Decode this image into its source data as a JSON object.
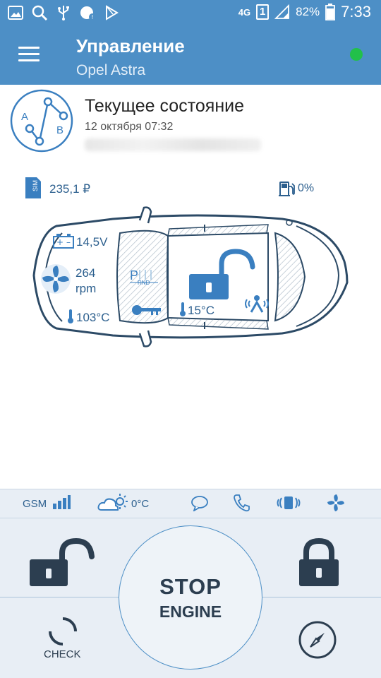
{
  "status_bar": {
    "network": "4G",
    "sim_slot": "1",
    "battery": "82%",
    "time": "7:33",
    "icons": [
      "image-icon",
      "search-icon",
      "usb-icon",
      "data-saver-icon",
      "play-store-icon",
      "signal-icon",
      "battery-icon"
    ]
  },
  "header": {
    "title": "Управление",
    "subtitle": "Opel Astra",
    "connection_color": "#22c04a"
  },
  "state": {
    "title": "Текущее состояние",
    "date": "12 октября 07:32",
    "logo_labels": {
      "a": "A",
      "b": "B"
    }
  },
  "sim": {
    "label": "SIM",
    "balance": "235,1 ₽"
  },
  "fuel": {
    "level": "0%"
  },
  "car": {
    "voltage": "14,5V",
    "rpm_value": "264",
    "rpm_unit": "rpm",
    "engine_temp": "103°C",
    "cabin_temp": "15°C",
    "gear_letters": {
      "park": "P",
      "others": "RND"
    }
  },
  "info_strip": {
    "gsm_label": "GSM",
    "outside_temp": "0°C"
  },
  "controls": {
    "stop_line1": "STOP",
    "stop_line2": "ENGINE",
    "check_label": "CHECK"
  },
  "colors": {
    "primary": "#4d8fc6",
    "icon_blue": "#3a7fc0",
    "dark": "#2c3e50",
    "panel": "#e8eef5"
  }
}
